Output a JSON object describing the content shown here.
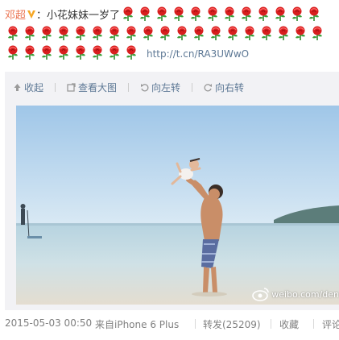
{
  "post": {
    "author": "邓超",
    "colon": "：",
    "text": "小花妹妹一岁了",
    "rose_icon": "rose-emoji-icon",
    "link": "http://t.cn/RA3UWwO"
  },
  "toolbar": {
    "collapse": "收起",
    "view_large": "查看大图",
    "rotate_left": "向左转",
    "rotate_right": "向右转"
  },
  "photo": {
    "watermark": "weibo.com/den"
  },
  "footer": {
    "date": "2015-05-03 00:50",
    "source": "来自iPhone 6 Plus",
    "repost": "转发(25209)",
    "favorite": "收藏",
    "comment": "评论"
  },
  "colors": {
    "link": "#5d7895",
    "author": "#eb7350",
    "verified": "#f5a623",
    "toolbar_bg": "#f2f2f5"
  }
}
